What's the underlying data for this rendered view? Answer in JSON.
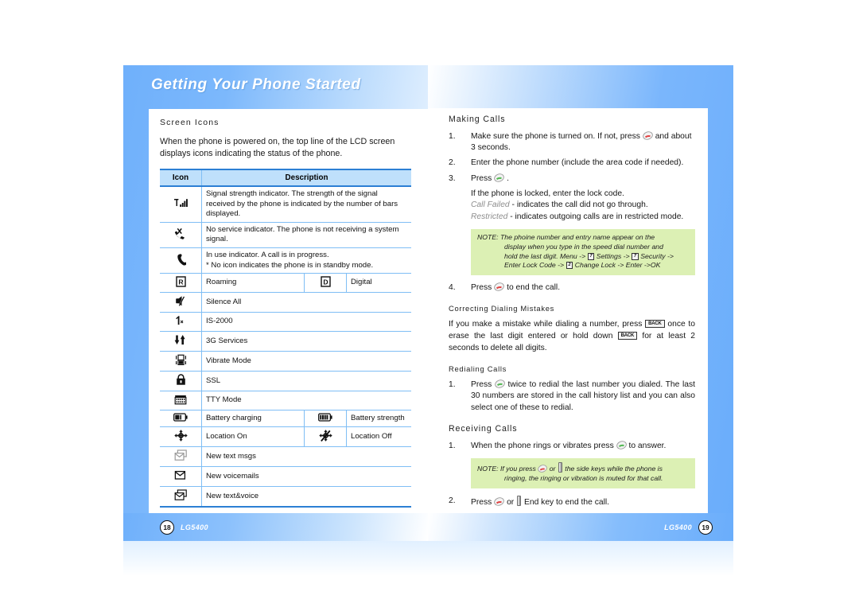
{
  "book_title": "Getting Your Phone Started",
  "left_page": {
    "section_heading": "Screen Icons",
    "intro": "When the phone is powered on, the top line of the LCD screen displays icons indicating the status of the phone.",
    "table": {
      "headers": [
        "Icon",
        "Description"
      ],
      "rows": [
        {
          "icon": "signal-strength-icon",
          "desc": "Signal strength indicator. The strength of the signal received by the phone is indicated by the number of bars displayed."
        },
        {
          "icon": "no-service-icon",
          "desc": "No service indicator. The phone is not receiving a system signal."
        },
        {
          "icon": "in-use-icon",
          "desc": "In use indicator. A call is in progress.",
          "desc2": "* No icon indicates the phone is in standby mode."
        },
        {
          "icon": "roaming-icon",
          "desc": "Roaming",
          "icon2": "digital-icon",
          "desc2": "Digital"
        },
        {
          "icon": "silence-all-icon",
          "desc": "Silence All"
        },
        {
          "icon": "is2000-icon",
          "desc": "IS-2000"
        },
        {
          "icon": "3g-services-icon",
          "desc": "3G Services"
        },
        {
          "icon": "vibrate-mode-icon",
          "desc": "Vibrate Mode"
        },
        {
          "icon": "ssl-lock-icon",
          "desc": "SSL"
        },
        {
          "icon": "tty-mode-icon",
          "desc": "TTY Mode"
        },
        {
          "icon": "battery-charging-icon",
          "desc": "Battery charging",
          "icon2": "battery-strength-icon",
          "desc2": "Battery strength"
        },
        {
          "icon": "location-on-icon",
          "desc": "Location On",
          "icon2": "location-off-icon",
          "desc2": "Location Off"
        },
        {
          "icon": "new-text-msgs-icon",
          "desc": "New text msgs"
        },
        {
          "icon": "new-voicemails-icon",
          "desc": "New voicemails"
        },
        {
          "icon": "new-text-voice-icon",
          "desc": "New text&voice"
        }
      ]
    },
    "footer": {
      "page_number": "18",
      "model": "LG5400"
    }
  },
  "right_page": {
    "making_calls": {
      "heading": "Making Calls",
      "step1_num": "1.",
      "step1_a": "Make sure the phone is turned on. If not, press",
      "step1_b": "and about 3 seconds.",
      "step2_num": "2.",
      "step2": "Enter the phone number (include the area code if needed).",
      "step3_num": "3.",
      "step3": "Press",
      "step3_end": ".",
      "locked_line": "If the phone is locked, enter the lock code.",
      "call_failed_label": "Call Failed",
      "call_failed_text": "- indicates the call did not go through.",
      "restricted_label": "Restricted",
      "restricted_text": "- indicates outgoing calls are in restricted mode."
    },
    "note1": {
      "label": "NOTE:",
      "line1": "The phoine number and entry name appear on the",
      "line2": "display when you type in the speed dial number and",
      "line3_a": "hold the last digit. Menu ->",
      "key7a": "7",
      "line3_b": "Settings ->",
      "key7b": "7",
      "line3_c": "Security ->",
      "line4_a": "Enter Lock Code ->",
      "key2": "2",
      "line4_b": "Change Lock -> Enter ->OK"
    },
    "step4_num": "4.",
    "step4_a": "Press",
    "step4_b": "to end the call.",
    "correcting": {
      "heading": "Correcting Dialing Mistakes",
      "text_a": "If you make a mistake while dialing a number, press",
      "back_key": "BACK",
      "text_b": "once to erase the last digit entered or hold down",
      "back_key2": "BACK",
      "text_c": "for at least 2 seconds to delete all digits."
    },
    "redialing": {
      "heading": "Redialing Calls",
      "step1_num": "1.",
      "step1_a": "Press",
      "step1_b": "twice to redial the last number you dialed. The last 30 numbers are stored in the call history list and you can also select one of these to redial."
    },
    "receiving": {
      "heading": "Receiving Calls",
      "step1_num": "1.",
      "step1_a": "When the phone rings or vibrates press",
      "step1_b": "to answer."
    },
    "note2": {
      "label": "NOTE:",
      "line1_a": "If you press",
      "line1_b": "or",
      "line1_c": "the side keys while the phone is",
      "line2": "ringing, the ringing or vibration is muted for that call."
    },
    "step2_num": "2.",
    "step2_a": "Press",
    "step2_b": "or",
    "step2_c": "End key to end the call.",
    "footer": {
      "page_number": "19",
      "model": "LG5400"
    }
  }
}
